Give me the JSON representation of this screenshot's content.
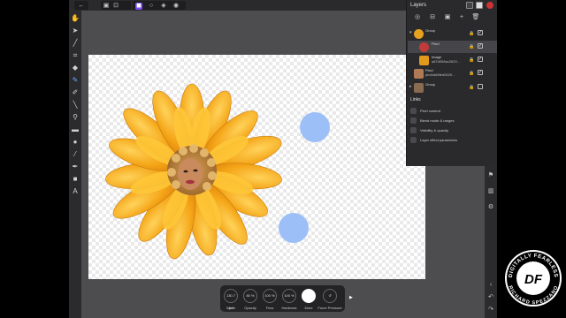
{
  "top_toolbar": {
    "back_icon": "arrow-left",
    "icons": [
      "document",
      "history",
      "pixel-persona",
      "circle-persona",
      "cube-persona",
      "export-persona"
    ]
  },
  "layers_panel": {
    "title": "Layers",
    "header_icons": [
      "grid",
      "pen",
      "color-wheel"
    ],
    "toolbar_icons": [
      "opacity",
      "add-group",
      "mask",
      "add",
      "delete"
    ],
    "rows": [
      {
        "name": "Group",
        "sub": "",
        "checked": true,
        "thumb_color": "#e6a11f"
      },
      {
        "name": "Pixel",
        "sub": "",
        "checked": true,
        "thumb_color": "#c23b3b"
      },
      {
        "name": "Image",
        "sub": "a87d058ac2620…",
        "checked": true,
        "thumb_color": "#e29a1c"
      },
      {
        "name": "Pixel",
        "sub": "pbd4dd5fed2629…",
        "checked": true,
        "thumb_color": "#b07a55"
      },
      {
        "name": "Group",
        "sub": "",
        "checked": false,
        "thumb_color": "#8a6a50"
      }
    ],
    "links_title": "Links",
    "links": [
      "Pixel content",
      "Blend mode & ranges",
      "Visibility & opacity",
      "Layer effect parameters"
    ]
  },
  "context_toolbar": {
    "items": [
      {
        "value": "130.7 px",
        "label": "Width"
      },
      {
        "value": "80 %",
        "label": "Opacity"
      },
      {
        "value": "100 %",
        "label": "Flow"
      },
      {
        "value": "100 %",
        "label": "Hardness"
      },
      {
        "value": "",
        "label": "More"
      },
      {
        "value": "",
        "label": "Force Pressure"
      }
    ]
  },
  "colors": {
    "accent": "#7c4dff",
    "brush_dot": "#9dbff8",
    "flower": "#f2a518"
  },
  "watermark": {
    "top_text": "DIGITALLY FEARLESS",
    "bottom_text": "RICHARD SPEZZANO",
    "logo": "DF"
  }
}
